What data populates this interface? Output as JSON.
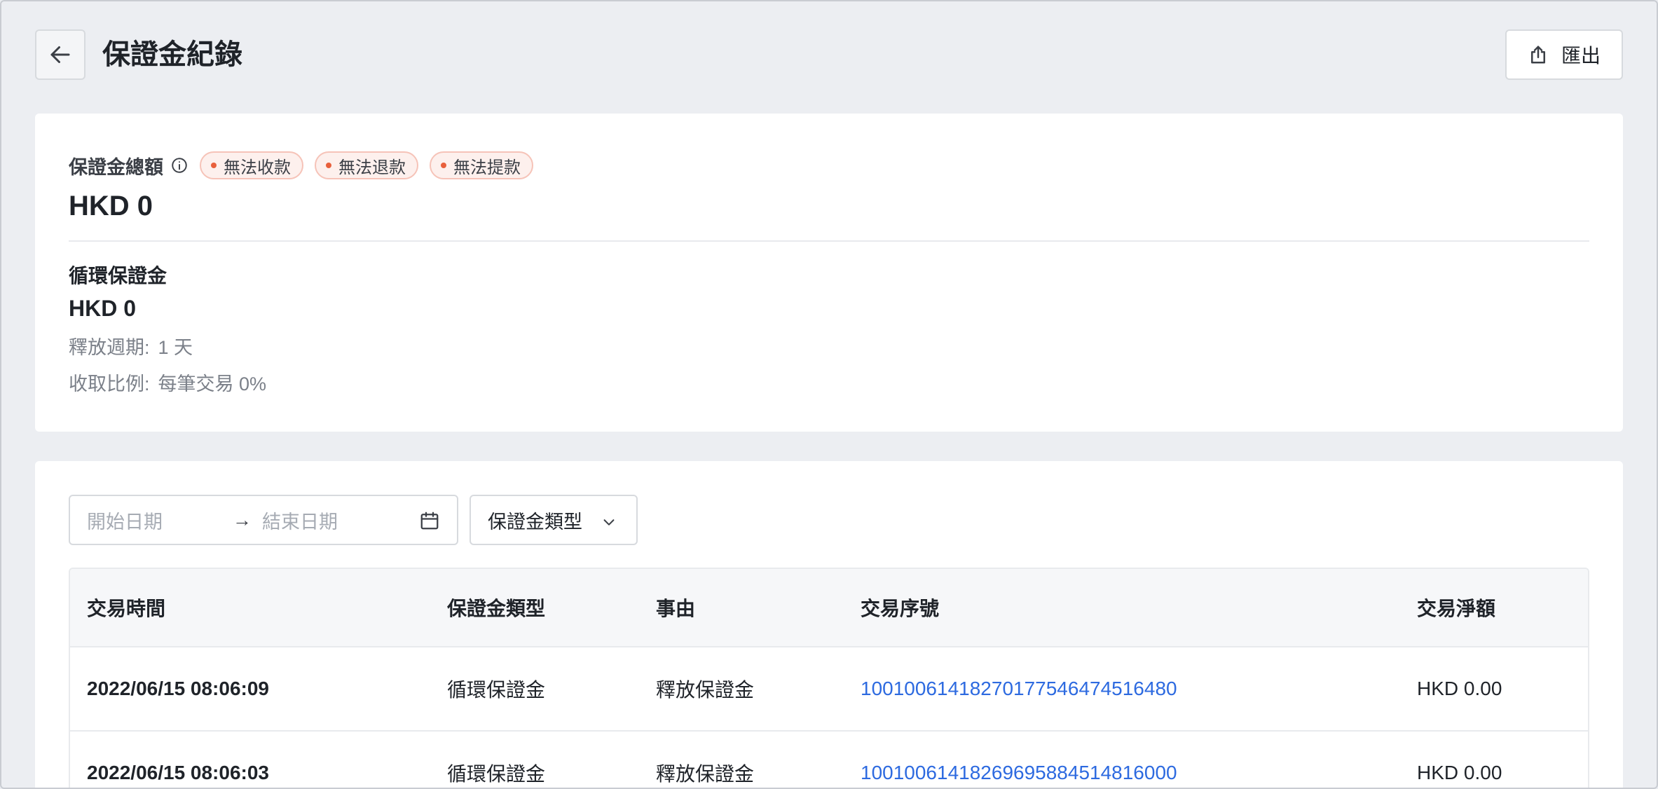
{
  "header": {
    "title": "保證金紀錄",
    "export_label": "匯出"
  },
  "summary": {
    "total_label": "保證金總額",
    "tags": [
      "無法收款",
      "無法退款",
      "無法提款"
    ],
    "total_amount": "HKD 0",
    "revolving": {
      "label": "循環保證金",
      "amount": "HKD 0",
      "release_period_label": "釋放週期:",
      "release_period_value": "1 天",
      "rate_label": "收取比例:",
      "rate_value": "每筆交易 0%"
    }
  },
  "filters": {
    "start_placeholder": "開始日期",
    "arrow": "→",
    "end_placeholder": "結束日期",
    "type_select_label": "保證金類型"
  },
  "table": {
    "columns": [
      "交易時間",
      "保證金類型",
      "事由",
      "交易序號",
      "交易淨額"
    ],
    "rows": [
      [
        "2022/06/15 08:06:09",
        "循環保證金",
        "釋放保證金",
        "1001006141827017754647451648​0",
        "HKD 0.00"
      ],
      [
        "2022/06/15 08:06:03",
        "循環保證金",
        "釋放保證金",
        "10010061418269695884514816000",
        "HKD 0.00"
      ]
    ]
  },
  "colors": {
    "accent_link": "#2d6ae0",
    "tag_dot": "#e8603c",
    "tag_bg": "#fdf0ed"
  },
  "icons": [
    "arrow-left-icon",
    "export-icon",
    "info-icon",
    "calendar-icon",
    "chevron-down-icon"
  ]
}
